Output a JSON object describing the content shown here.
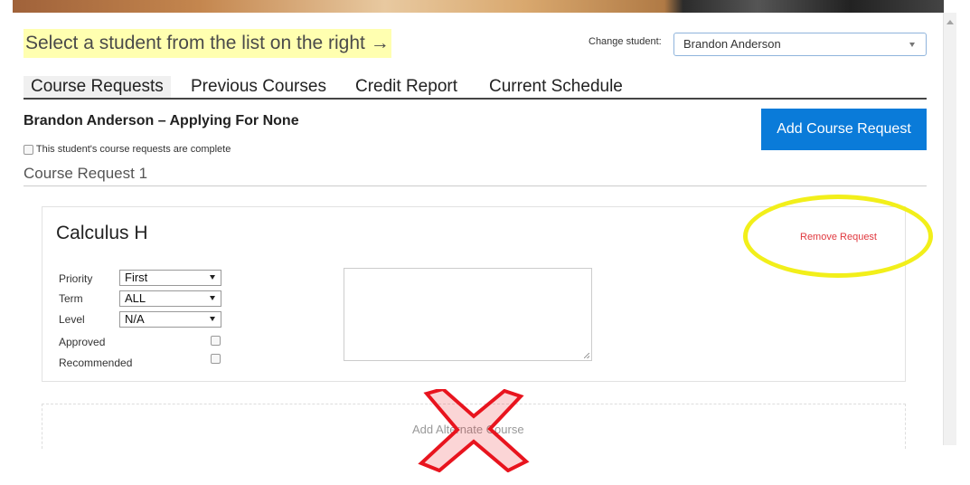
{
  "header": {
    "prompt": "Select a student from the list on the right →",
    "change_student_label": "Change student:",
    "selected_student": "Brandon Anderson"
  },
  "tabs": [
    {
      "label": "Course Requests",
      "active": true
    },
    {
      "label": "Previous Courses",
      "active": false
    },
    {
      "label": "Credit Report",
      "active": false
    },
    {
      "label": "Current Schedule",
      "active": false
    }
  ],
  "student": {
    "heading": "Brandon Anderson – Applying For None",
    "complete_label": "This student's course requests are complete",
    "complete_checked": false
  },
  "actions": {
    "add_course_request": "Add Course Request"
  },
  "request": {
    "title": "Course Request 1",
    "course_name": "Calculus H",
    "remove_label": "Remove Request",
    "fields": {
      "priority_label": "Priority",
      "priority_value": "First",
      "term_label": "Term",
      "term_value": "ALL",
      "level_label": "Level",
      "level_value": "N/A",
      "approved_label": "Approved",
      "approved_checked": false,
      "recommended_label": "Recommended",
      "recommended_checked": false
    },
    "notes": ""
  },
  "alternate": {
    "label": "Add Alternate Course"
  },
  "annotation_colors": {
    "highlight": "#f2ef1a",
    "strike": "#e8141e",
    "button": "#0a7bd9"
  }
}
